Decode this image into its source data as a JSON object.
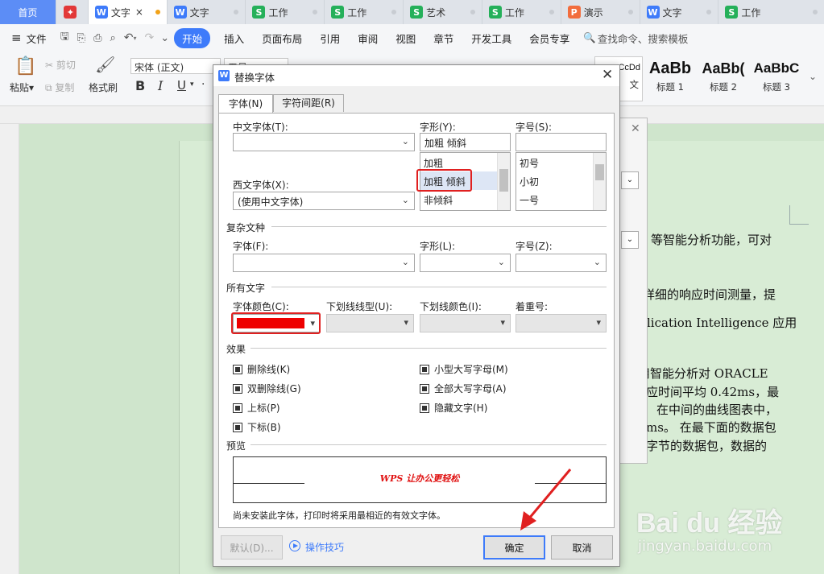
{
  "tabs": [
    {
      "label": "首页",
      "icon": "",
      "color": "#5c8df6"
    },
    {
      "label": "",
      "icon": "wps-logo-icon",
      "color": "#e23838"
    },
    {
      "label": "文字",
      "icon": "W",
      "color": "#3e7bfa"
    },
    {
      "label": "文字",
      "icon": "W",
      "color": "#3e7bfa"
    },
    {
      "label": "工作",
      "icon": "S",
      "color": "#25b05a"
    },
    {
      "label": "工作",
      "icon": "S",
      "color": "#25b05a"
    },
    {
      "label": "艺术",
      "icon": "S",
      "color": "#25b05a"
    },
    {
      "label": "工作",
      "icon": "S",
      "color": "#25b05a"
    },
    {
      "label": "演示",
      "icon": "P",
      "color": "#f26d3d"
    },
    {
      "label": "文字",
      "icon": "W",
      "color": "#3e7bfa"
    },
    {
      "label": "工作",
      "icon": "S",
      "color": "#25b05a"
    }
  ],
  "menu": {
    "file": "文件",
    "items": [
      "开始",
      "插入",
      "页面布局",
      "引用",
      "审阅",
      "视图",
      "章节",
      "开发工具",
      "会员专享"
    ],
    "search": "查找命令、搜索模板"
  },
  "ribbon": {
    "paste": "粘贴",
    "cut": "剪切",
    "copy": "复制",
    "format_painter": "格式刷",
    "font_name": "宋体 (正文)",
    "font_size": "五号",
    "styles": [
      {
        "sample": "AaBb",
        "label": "标题 1"
      },
      {
        "sample": "AaBb(",
        "label": "标题 2"
      },
      {
        "sample": "AaBbC",
        "label": "标题 3"
      }
    ],
    "normal_sample": "CcDd",
    "normal_label": "文"
  },
  "document_lines": [
    "等智能分析功能，可对",
    "详细的响应时间测量，提",
    "lication Intelligence 应用",
    "用智能分析对 ORACLE",
    "应时间平均 0.42ms，最",
    "在中间的曲线图表中，",
    "ms。 在最下面的数据包",
    "字节的数据包，数据的"
  ],
  "dialog": {
    "title": "替换字体",
    "tabs": [
      "字体(N)",
      "字符间距(R)"
    ],
    "cn_font_label": "中文字体(T):",
    "cn_font_value": "",
    "style_label": "字形(Y):",
    "style_value": "加粗 倾斜",
    "style_options": [
      "加粗",
      "加粗 倾斜",
      "非倾斜"
    ],
    "size_label": "字号(S):",
    "size_value": "",
    "size_options": [
      "初号",
      "小初",
      "一号"
    ],
    "west_font_label": "西文字体(X):",
    "west_font_value": "(使用中文字体)",
    "complex_section": "复杂文种",
    "complex_font_label": "字体(F):",
    "complex_style_label": "字形(L):",
    "complex_size_label": "字号(Z):",
    "all_text_section": "所有文字",
    "font_color_label": "字体颜色(C):",
    "font_color": "#ee0000",
    "underline_type_label": "下划线线型(U):",
    "underline_color_label": "下划线颜色(I):",
    "emphasis_label": "着重号:",
    "effects_section": "效果",
    "effects_left": [
      "删除线(K)",
      "双删除线(G)",
      "上标(P)",
      "下标(B)"
    ],
    "effects_right": [
      "小型大写字母(M)",
      "全部大写字母(A)",
      "隐藏文字(H)"
    ],
    "preview_section": "预览",
    "preview_text": "WPS 让办公更轻松",
    "note": "尚未安装此字体，打印时将采用最相近的有效文字体。",
    "default_button": "默认(D)...",
    "tips_link": "操作技巧",
    "ok_button": "确定",
    "cancel_button": "取消"
  },
  "watermark": {
    "brand": "Bai du 经验",
    "url": "jingyan.baidu.com"
  },
  "accent_color": "#3e7bfa",
  "highlight_color": "#e02020"
}
